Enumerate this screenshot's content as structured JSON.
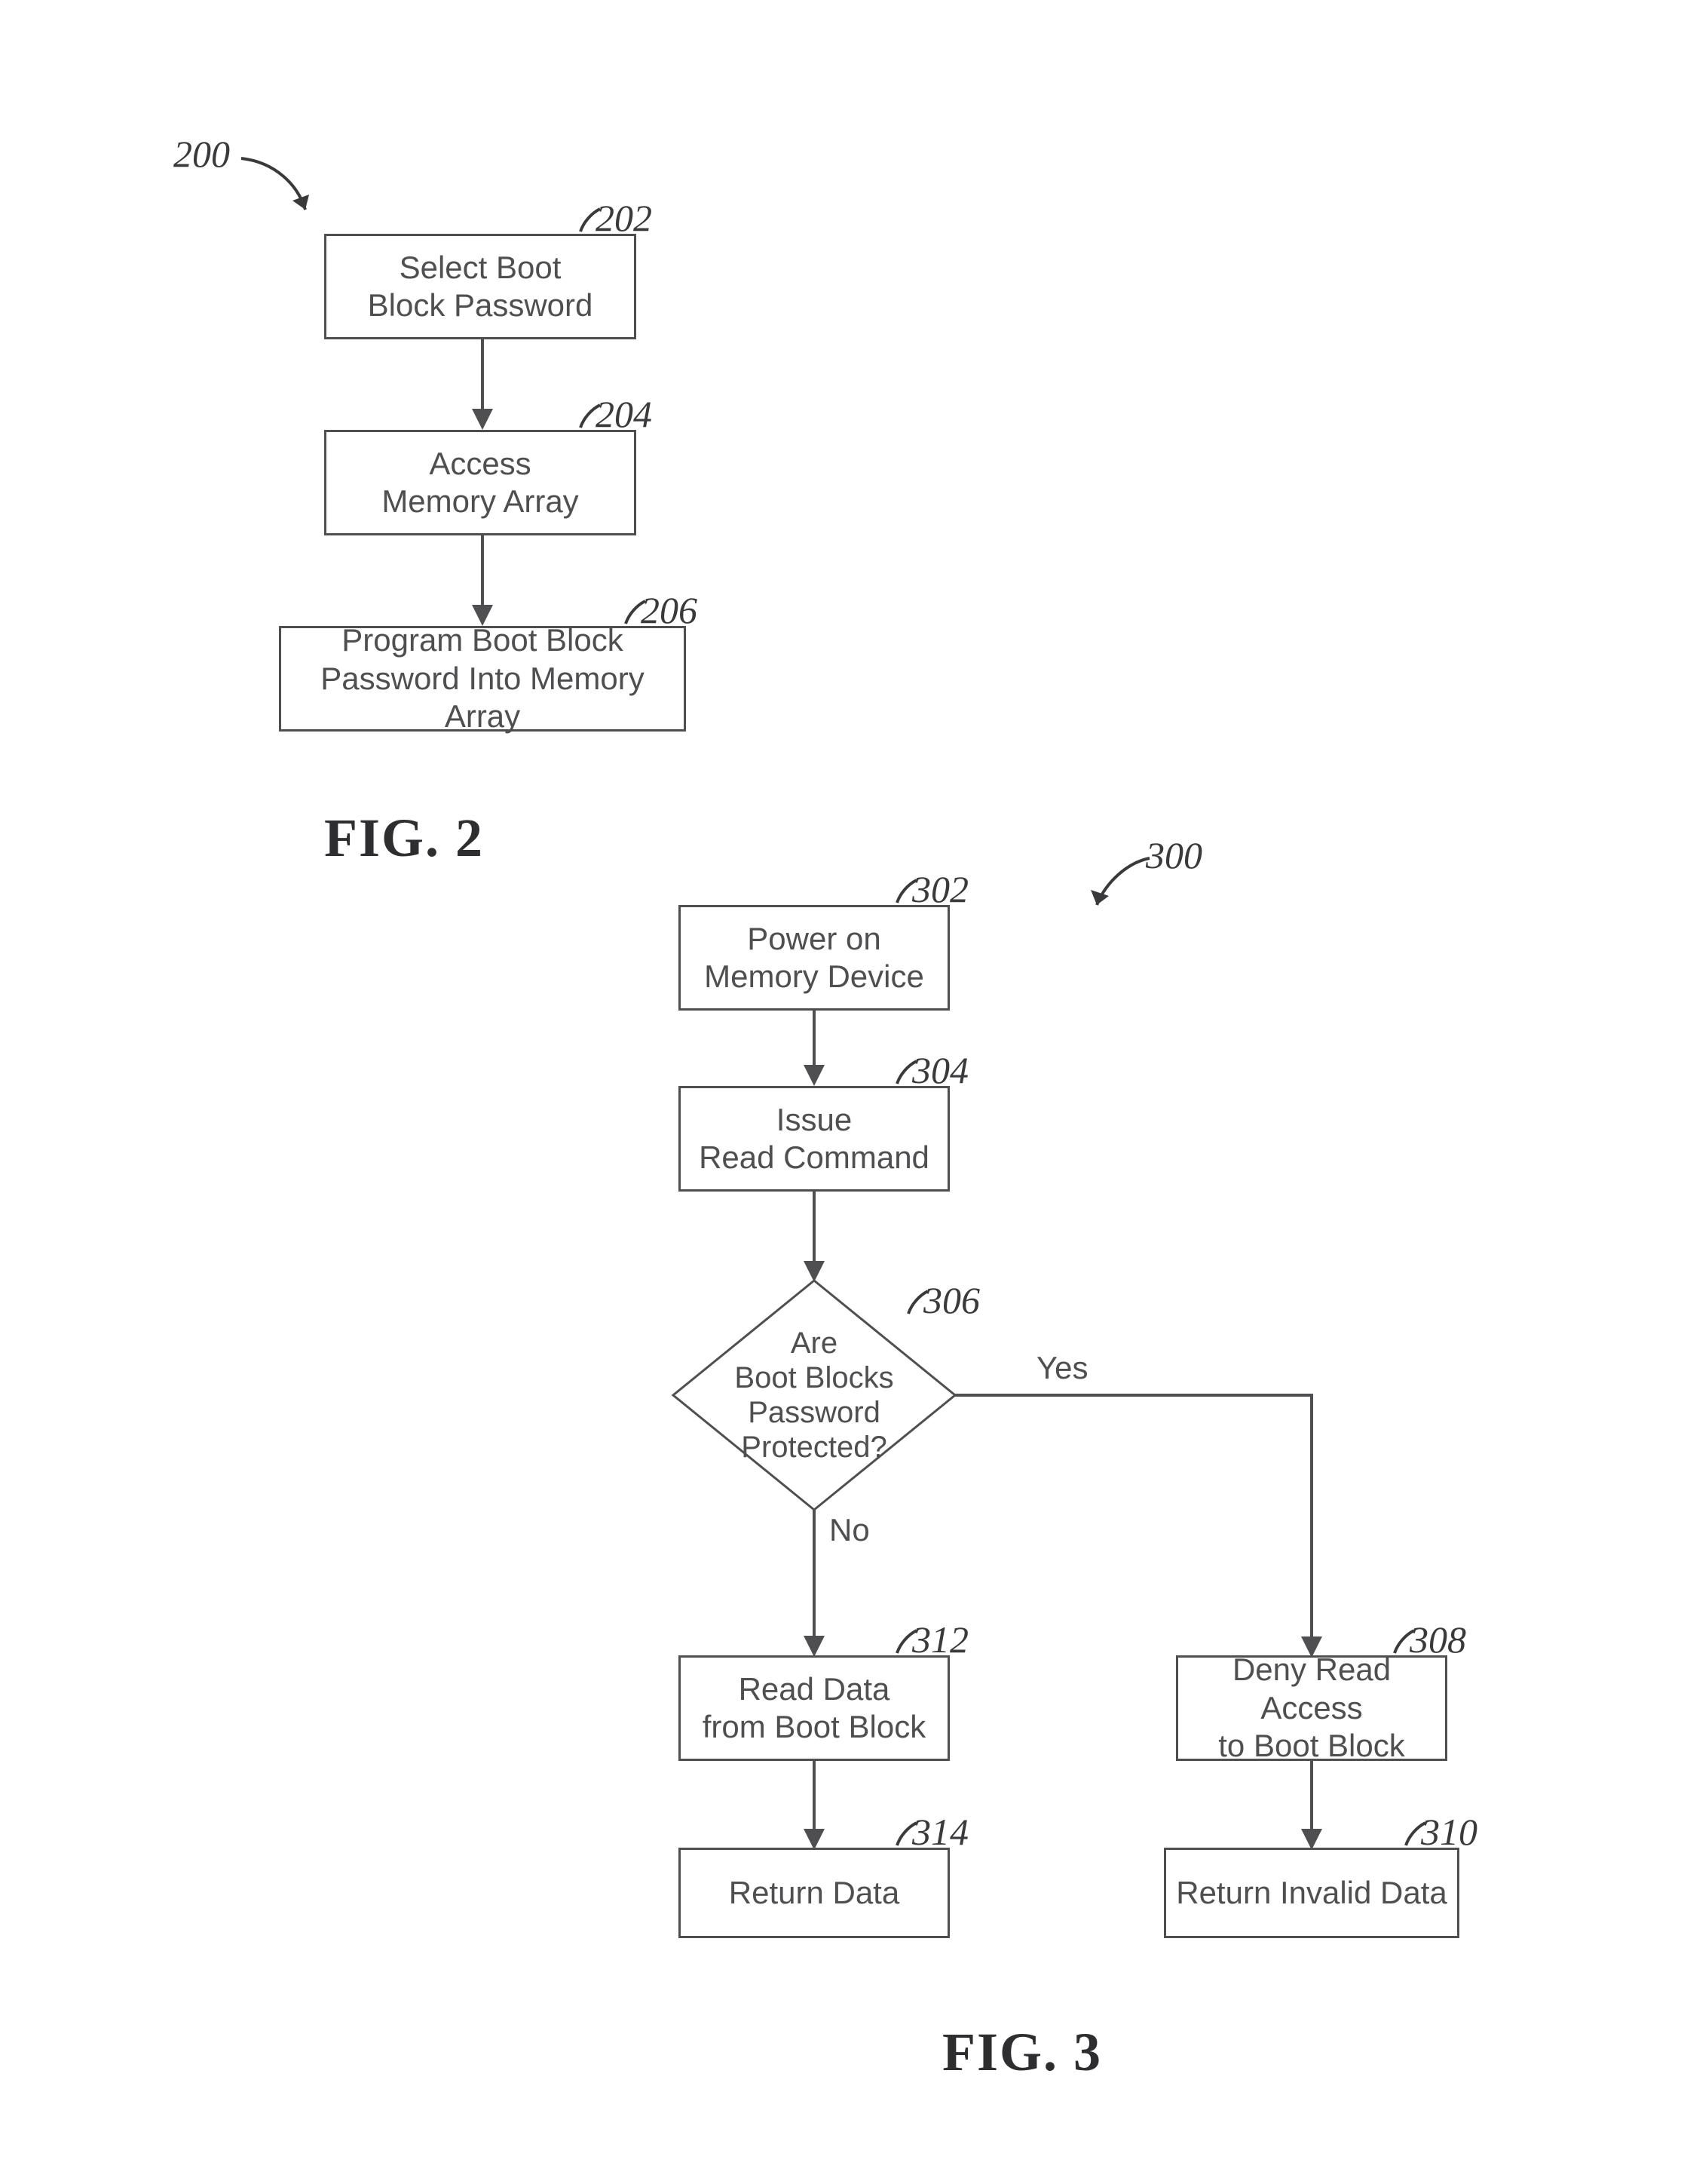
{
  "fig2": {
    "title_ref": "200",
    "caption": "FIG. 2",
    "blocks": {
      "b202": {
        "ref": "202",
        "line1": "Select Boot",
        "line2": "Block Password"
      },
      "b204": {
        "ref": "204",
        "line1": "Access",
        "line2": "Memory Array"
      },
      "b206": {
        "ref": "206",
        "line1": "Program Boot Block",
        "line2": "Password Into Memory Array"
      }
    }
  },
  "fig3": {
    "title_ref": "300",
    "caption": "FIG. 3",
    "blocks": {
      "b302": {
        "ref": "302",
        "line1": "Power on",
        "line2": "Memory Device"
      },
      "b304": {
        "ref": "304",
        "line1": "Issue",
        "line2": "Read Command"
      },
      "b306": {
        "ref": "306",
        "line1": "Are",
        "line2": "Boot Blocks",
        "line3": "Password",
        "line4": "Protected?"
      },
      "b308": {
        "ref": "308",
        "line1": "Deny Read Access",
        "line2": "to Boot Block"
      },
      "b310": {
        "ref": "310",
        "line1": "Return Invalid Data"
      },
      "b312": {
        "ref": "312",
        "line1": "Read Data",
        "line2": "from Boot Block"
      },
      "b314": {
        "ref": "314",
        "line1": "Return Data"
      }
    },
    "edges": {
      "yes": "Yes",
      "no": "No"
    }
  }
}
